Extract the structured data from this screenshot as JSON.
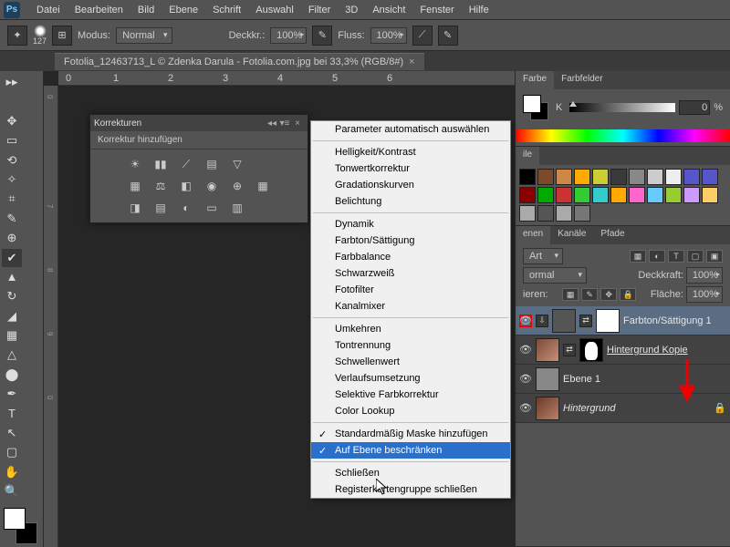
{
  "menubar": [
    "Datei",
    "Bearbeiten",
    "Bild",
    "Ebene",
    "Schrift",
    "Auswahl",
    "Filter",
    "3D",
    "Ansicht",
    "Fenster",
    "Hilfe"
  ],
  "optbar": {
    "brush_size": "127",
    "modus_label": "Modus:",
    "modus_value": "Normal",
    "deckkr_label": "Deckkr.:",
    "deckkr_value": "100%",
    "fluss_label": "Fluss:",
    "fluss_value": "100%"
  },
  "doc_tab": "Fotolia_12463713_L © Zdenka Darula - Fotolia.com.jpg bei 33,3% (RGB/8#)",
  "ruler_h": [
    "0",
    "1",
    "2",
    "3",
    "4",
    "5",
    "6"
  ],
  "ruler_v": [
    "0",
    "7",
    "8",
    "9",
    "0"
  ],
  "korr": {
    "title": "Korrekturen",
    "subtitle": "Korrektur hinzufügen"
  },
  "ctx": {
    "items": [
      {
        "t": "Parameter automatisch auswählen"
      },
      {
        "sep": true
      },
      {
        "t": "Helligkeit/Kontrast"
      },
      {
        "t": "Tonwertkorrektur"
      },
      {
        "t": "Gradationskurven"
      },
      {
        "t": "Belichtung"
      },
      {
        "sep": true
      },
      {
        "t": "Dynamik"
      },
      {
        "t": "Farbton/Sättigung"
      },
      {
        "t": "Farbbalance"
      },
      {
        "t": "Schwarzweiß"
      },
      {
        "t": "Fotofilter"
      },
      {
        "t": "Kanalmixer"
      },
      {
        "sep": true
      },
      {
        "t": "Umkehren"
      },
      {
        "t": "Tontrennung"
      },
      {
        "t": "Schwellenwert"
      },
      {
        "t": "Verlaufsumsetzung"
      },
      {
        "t": "Selektive Farbkorrektur"
      },
      {
        "t": "Color Lookup"
      },
      {
        "sep": true
      },
      {
        "t": "Standardmäßig Maske hinzufügen",
        "check": true
      },
      {
        "t": "Auf Ebene beschränken",
        "check": true,
        "sel": true
      },
      {
        "sep": true
      },
      {
        "t": "Schließen"
      },
      {
        "t": "Registerkartengruppe schließen"
      }
    ]
  },
  "farbe": {
    "tab1": "Farbe",
    "tab2": "Farbfelder",
    "channel": "K",
    "value": "0",
    "pct": "%"
  },
  "stile": {
    "tab": "ile"
  },
  "swatches": [
    "#000",
    "#7a4a2a",
    "#c84",
    "#fa0",
    "#cc3",
    "#3a3a3a",
    "#888",
    "#ccc",
    "#eee",
    "#55c",
    "#55c",
    "#800",
    "#0a0",
    "#c33",
    "#3c3",
    "#3cc",
    "#fa0",
    "#f6c",
    "#6cf",
    "#9c3",
    "#c9f",
    "#fc6",
    "#aaa",
    "#555",
    "#aaa",
    "#777"
  ],
  "layers": {
    "tabs": [
      "enen",
      "Kanäle",
      "Pfade"
    ],
    "kind_label": "Art",
    "blend": "ormal",
    "deckkr_label": "Deckkraft:",
    "deckkr_val": "100%",
    "fix_label": "ieren:",
    "flaeche_label": "Fläche:",
    "flaeche_val": "100%",
    "items": [
      {
        "name": "Farbton/Sättigung 1",
        "adj": true,
        "sel": true,
        "redbox": true
      },
      {
        "name": "Hintergrund Kopie",
        "mask": true,
        "underline": true
      },
      {
        "name": "Ebene 1",
        "plain": true
      },
      {
        "name": "Hintergrund",
        "italic": true,
        "lock": true
      }
    ]
  }
}
